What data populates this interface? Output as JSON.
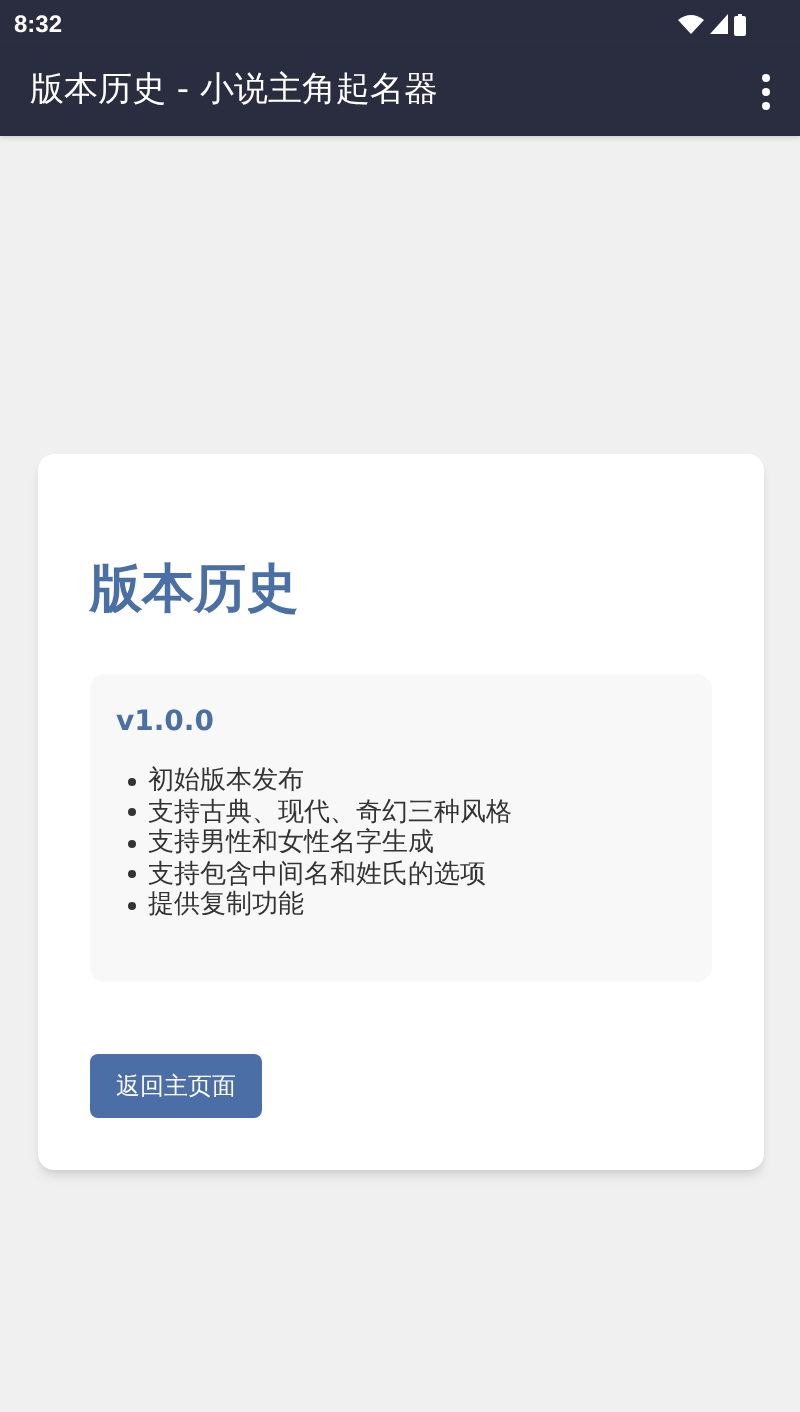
{
  "status_bar": {
    "time": "8:32"
  },
  "app_bar": {
    "title": "版本历史 - 小说主角起名器"
  },
  "card": {
    "title": "版本历史",
    "versions": [
      {
        "version": "v1.0.0",
        "changes": [
          "初始版本发布",
          "支持古典、现代、奇幻三种风格",
          "支持男性和女性名字生成",
          "支持包含中间名和姓氏的选项",
          "提供复制功能"
        ]
      }
    ],
    "button": "返回主页面"
  }
}
